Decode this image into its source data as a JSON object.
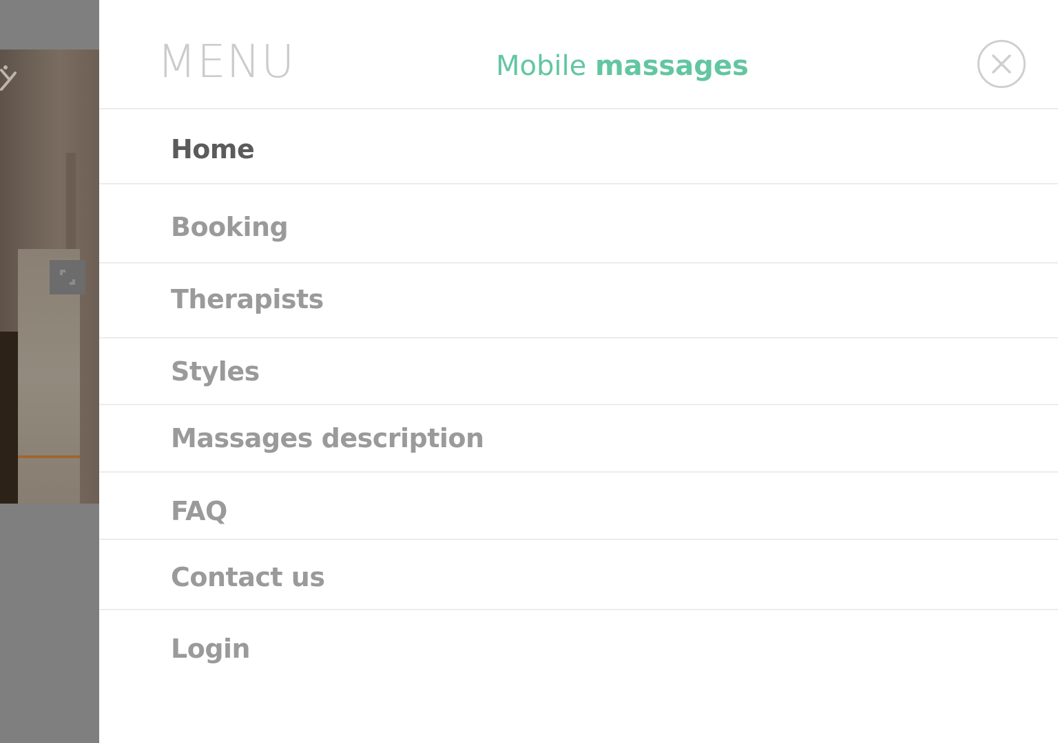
{
  "header": {
    "menu_title": "MENU",
    "brand_light": "Mobile",
    "brand_bold": "massages",
    "brand_color": "#62c6a1",
    "close_icon": "close-circle-icon"
  },
  "menu": {
    "active_index": 0,
    "items": [
      {
        "label": "Home"
      },
      {
        "label": "Booking"
      },
      {
        "label": "Therapists"
      },
      {
        "label": "Styles"
      },
      {
        "label": "Massages description"
      },
      {
        "label": "FAQ"
      },
      {
        "label": "Contact us"
      },
      {
        "label": "Login"
      }
    ]
  },
  "background": {
    "expand_icon": "expand-icon",
    "overlay_color": "#7f7f7f"
  }
}
